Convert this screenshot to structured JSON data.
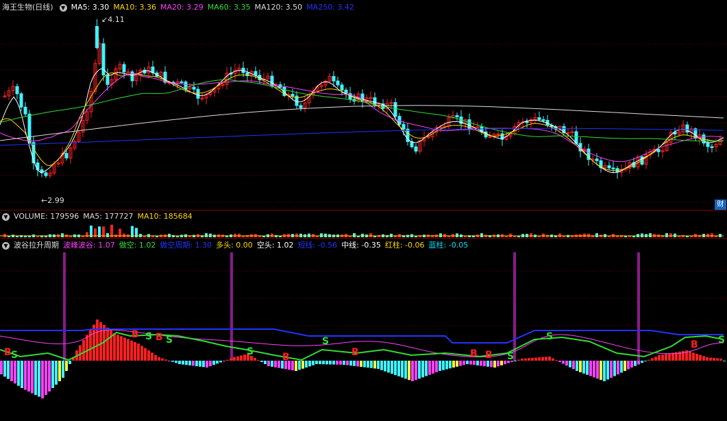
{
  "main": {
    "title": "海王生物(日线)",
    "ma": [
      {
        "label": "MA5: ",
        "value": "3.30",
        "color": "#ffffff"
      },
      {
        "label": "MA10: ",
        "value": "3.36",
        "color": "#ffd700"
      },
      {
        "label": "MA20: ",
        "value": "3.29",
        "color": "#ff40ff"
      },
      {
        "label": "MA60: ",
        "value": "3.35",
        "color": "#33dd33"
      },
      {
        "label": "MA120: ",
        "value": "3.50",
        "color": "#dddddd"
      },
      {
        "label": "MA250: ",
        "value": "3.42",
        "color": "#2233ff"
      }
    ],
    "high_label": "4.11",
    "low_label": "2.99",
    "fin_badge": "财"
  },
  "volume": {
    "title": "VOLUME: ",
    "value": "179596",
    "ma5_label": "MA5: ",
    "ma5_value": "177727",
    "ma10_label": "MA10: ",
    "ma10_value": "185684"
  },
  "indicator": {
    "title": "波谷拉升周期",
    "items": [
      {
        "label": "波峰波谷: ",
        "value": "1.07",
        "color": "#ff40ff"
      },
      {
        "label": "做空: ",
        "value": "1.02",
        "color": "#33dd33"
      },
      {
        "label": "做空周期: ",
        "value": "1.30",
        "color": "#2233ff"
      },
      {
        "label": "多头: ",
        "value": "0.00",
        "color": "#ffd700"
      },
      {
        "label": "空头: ",
        "value": "1.02",
        "color": "#ffffff"
      },
      {
        "label": "短线: ",
        "value": "-0.56",
        "color": "#2233ff"
      },
      {
        "label": "中线: ",
        "value": "-0.35",
        "color": "#ffffff"
      },
      {
        "label": "红柱: ",
        "value": "-0.06",
        "color": "#ffd700"
      },
      {
        "label": "蓝柱: ",
        "value": "-0.05",
        "color": "#00e5ff"
      }
    ],
    "markers": [
      "B",
      "S",
      "B",
      "S",
      "B",
      "S",
      "S",
      "B",
      "S",
      "B",
      "B",
      "B",
      "S",
      "S",
      "B",
      "S"
    ]
  },
  "colors": {
    "up": "#ff2020",
    "down": "#3ff3ff",
    "grid": "#7a0000",
    "magenta": "#ff40ff",
    "green": "#33dd33",
    "yellow": "#ffff40",
    "blue": "#2233ff",
    "purple": "#8a1a8a"
  }
}
